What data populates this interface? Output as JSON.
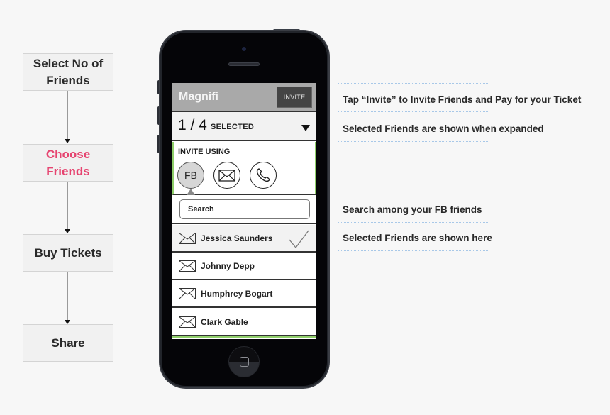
{
  "flow": {
    "steps": [
      {
        "label": "Select No of Friends",
        "line1": "Select No of",
        "line2": "Friends",
        "active": false
      },
      {
        "label": "Choose Friends",
        "line1": "Choose",
        "line2": "Friends",
        "active": true
      },
      {
        "label": "Buy Tickets",
        "line1": "Buy Tickets",
        "line2": "",
        "active": false
      },
      {
        "label": "Share",
        "line1": "Share",
        "line2": "",
        "active": false
      }
    ],
    "active_color": "#e64470"
  },
  "app": {
    "title": "Magnifi",
    "invite_button": "INVITE",
    "selected_count": "1 / 4",
    "selected_label": "SELECTED",
    "invite_using_label": "INVITE USING",
    "channels": [
      {
        "name": "facebook",
        "label": "FB",
        "icon": "fb-icon",
        "active": true
      },
      {
        "name": "email",
        "label": "",
        "icon": "envelope-icon",
        "active": false
      },
      {
        "name": "phone",
        "label": "",
        "icon": "phone-icon",
        "active": false
      }
    ],
    "search": {
      "placeholder": "Search",
      "value": ""
    },
    "friends": [
      {
        "name": "Jessica Saunders",
        "selected": true
      },
      {
        "name": "Johnny Depp",
        "selected": false
      },
      {
        "name": "Humphrey Bogart",
        "selected": false
      },
      {
        "name": "Clark Gable",
        "selected": false
      }
    ],
    "accent_green": "#8fcf6a"
  },
  "annotations": [
    "Tap “Invite” to Invite Friends and Pay for your Ticket",
    "Selected Friends are shown when expanded",
    "Search among your FB friends",
    "Selected Friends are shown here"
  ]
}
